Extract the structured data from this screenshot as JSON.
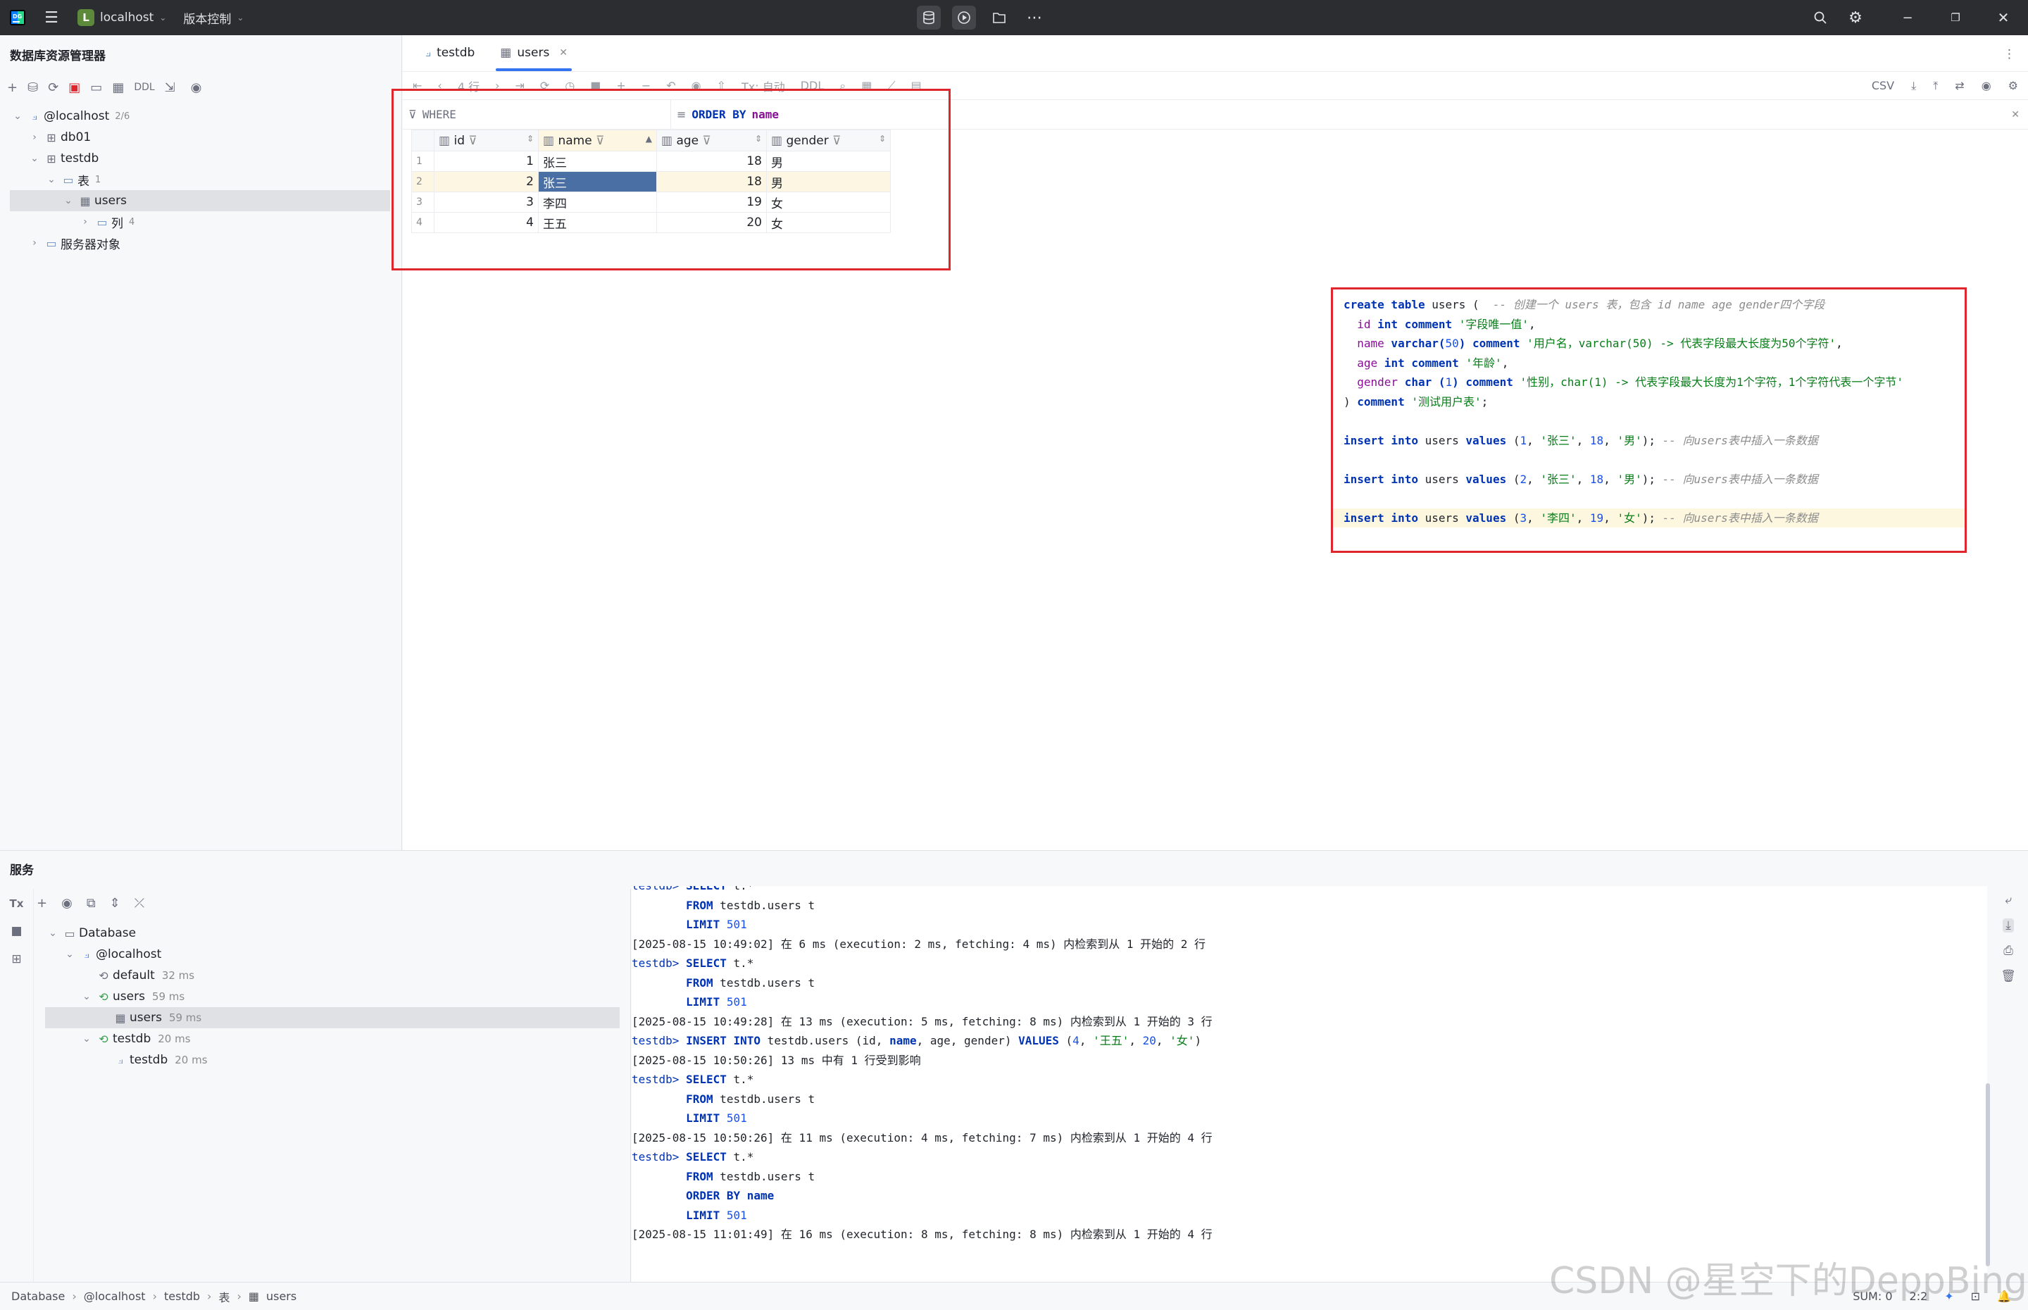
{
  "titlebar": {
    "project_badge": "L",
    "project_name": "localhost",
    "vcs_label": "版本控制"
  },
  "sidebar": {
    "title": "数据库资源管理器",
    "ddl_label": "DDL",
    "tree": [
      {
        "label": "@localhost",
        "count": "2/6",
        "icon": "datasource-icon"
      },
      {
        "label": "db01",
        "icon": "schema-icon"
      },
      {
        "label": "testdb",
        "icon": "schema-icon"
      },
      {
        "label": "表",
        "count": "1",
        "icon": "folder-icon"
      },
      {
        "label": "users",
        "icon": "table-icon"
      },
      {
        "label": "列",
        "count": "4",
        "icon": "folder-icon"
      },
      {
        "label": "服务器对象",
        "icon": "server-objects-icon"
      }
    ]
  },
  "editor": {
    "tabs": [
      {
        "label": "testdb",
        "icon": "console-icon"
      },
      {
        "label": "users",
        "icon": "table-icon"
      }
    ],
    "toolbar": {
      "rows_label": "4 行",
      "tx_label": "Tx: 自动",
      "ddl_label": "DDL",
      "export_label": "CSV"
    },
    "filter": {
      "where_label": "WHERE",
      "orderby_keyword": "ORDER BY",
      "orderby_field": "name"
    },
    "grid": {
      "columns": [
        "id",
        "name",
        "age",
        "gender"
      ],
      "rows": [
        {
          "rownum": "1",
          "id": "1",
          "name": "张三",
          "age": "18",
          "gender": "男"
        },
        {
          "rownum": "2",
          "id": "2",
          "name": "张三",
          "age": "18",
          "gender": "男"
        },
        {
          "rownum": "3",
          "id": "3",
          "name": "李四",
          "age": "19",
          "gender": "女"
        },
        {
          "rownum": "4",
          "id": "4",
          "name": "王五",
          "age": "20",
          "gender": "女"
        }
      ]
    },
    "sql": {
      "l1_kw": "create table",
      "l1_name": " users (  ",
      "l1_comment": "-- 创建一个 users 表，包含 id name age gender四个字段",
      "l2_field": "id",
      "l2_type": " int comment ",
      "l2_str": "'字段唯一值'",
      "l3_field": "name",
      "l3_type": " varchar(",
      "l3_num": "50",
      "l3_type2": ") comment ",
      "l3_str": "'用户名，varchar(50) -> 代表字段最大长度为50个字符'",
      "l4_field": "age",
      "l4_type": " int comment ",
      "l4_str": "'年龄'",
      "l5_field": "gender",
      "l5_type": " char (",
      "l5_num": "1",
      "l5_type2": ") comment ",
      "l5_str": "'性别，char(1) -> 代表字段最大长度为1个字符，1个字符代表一个字节'",
      "l6_close": ") ",
      "l6_kw": "comment",
      "l6_str": "'测试用户表'",
      "insert_kw": "insert into",
      "insert_tbl": " users ",
      "values_kw": "values",
      "ins1_num": "1",
      "ins1_s1": "'张三'",
      "ins1_age": "18",
      "ins1_s2": "'男'",
      "ins2_num": "2",
      "ins2_s1": "'张三'",
      "ins2_age": "18",
      "ins2_s2": "'男'",
      "ins3_num": "3",
      "ins3_s1": "'李四'",
      "ins3_age": "19",
      "ins3_s2": "'女'",
      "ins_comment": "-- 向users表中插入一条数据"
    }
  },
  "services": {
    "title": "服务",
    "tx_label": "Tx",
    "tree": [
      {
        "label": "Database",
        "ms": ""
      },
      {
        "label": "@localhost",
        "ms": ""
      },
      {
        "label": "default",
        "ms": "32 ms"
      },
      {
        "label": "users",
        "ms": "59 ms"
      },
      {
        "label": "users",
        "ms": "59 ms"
      },
      {
        "label": "testdb",
        "ms": "20 ms"
      },
      {
        "label": "testdb",
        "ms": "20 ms"
      }
    ],
    "console": {
      "prompt": "testdb>",
      "select_kw": "SELECT",
      "select_rest": " t.*",
      "from_kw": "FROM",
      "from_rest": " testdb.users t",
      "limit_kw": "LIMIT",
      "limit_num": "501",
      "orderby_kw": "ORDER BY",
      "orderby_field": "name",
      "log1": "[2025-08-15 10:49:02] 在 6 ms (execution: 2 ms, fetching: 4 ms) 内检索到从 1 开始的 2 行",
      "log2": "[2025-08-15 10:49:28] 在 13 ms (execution: 5 ms, fetching: 8 ms) 内检索到从 1 开始的 3 行",
      "insert_kw": "INSERT INTO",
      "insert_mid": " testdb.users (id, ",
      "insert_name": "name",
      "insert_mid2": ", age, gender) ",
      "values_kw": "VALUES",
      "insert_open": " (",
      "insert_n": "4",
      "insert_s1": "'王五'",
      "insert_age": "20",
      "insert_s2": "'女'",
      "insert_close": ")",
      "log3": "[2025-08-15 10:50:26] 13 ms 中有 1 行受到影响",
      "log4": "[2025-08-15 10:50:26] 在 11 ms (execution: 4 ms, fetching: 7 ms) 内检索到从 1 开始的 4 行",
      "log5": "[2025-08-15 11:01:49] 在 16 ms (execution: 8 ms, fetching: 8 ms) 内检索到从 1 开始的 4 行"
    }
  },
  "statusbar": {
    "breadcrumb": [
      "Database",
      "@localhost",
      "testdb",
      "表",
      "users"
    ],
    "sum": "SUM: 0",
    "position": "2:2",
    "watermark": "CSDN @星空下的DeppBing"
  },
  "colors": {
    "titlebar_bg": "#2b2d30",
    "accent": "#3574f0",
    "annotation_red": "#e0262d",
    "selected_cell": "#4a6fa5",
    "selected_row": "#fdf6e3"
  }
}
